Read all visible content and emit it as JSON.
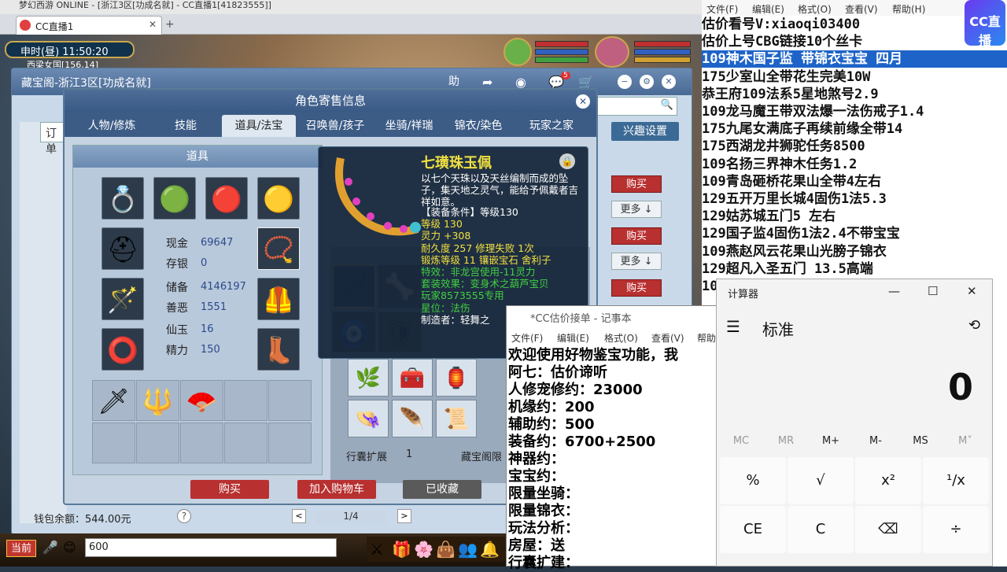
{
  "browser": {
    "top_text": "梦幻西游 ONLINE  -  [浙江3区[功成名就]  -  CC直播1[41823555]]",
    "tab_label": "CC直播1",
    "tab_close": "✕",
    "tab_add": "+"
  },
  "game": {
    "clock": "申时(昼)   11:50:20",
    "zone": "西梁女国[156,14]"
  },
  "cbg": {
    "title": "藏宝阁-浙江3区[功成名就]",
    "help": "助",
    "notif_count": "5",
    "order_tab": "订单",
    "interest_button": "兴趣设置",
    "buy_label": "购买",
    "more_label": "更多 ↓",
    "wallet": "钱包余额：544.00元",
    "help_q": "?",
    "page": "1/4",
    "prev": "<",
    "next": ">"
  },
  "role": {
    "title": "角色寄售信息",
    "close": "✕",
    "tabs": [
      "人物/修炼",
      "技能",
      "道具/法宝",
      "召唤兽/孩子",
      "坐骑/祥瑞",
      "锦衣/染色",
      "玩家之家"
    ],
    "active_tab": 2,
    "props_header": "道具",
    "stats": [
      {
        "label": "现金",
        "value": "69647"
      },
      {
        "label": "存银",
        "value": "0"
      },
      {
        "label": "储备",
        "value": "4146197"
      },
      {
        "label": "善恶",
        "value": "1551"
      },
      {
        "label": "仙玉",
        "value": "16"
      },
      {
        "label": "精力",
        "value": "150"
      }
    ],
    "bag_expand": "行囊扩展",
    "bag_expand_value": "1",
    "vault_label": "藏宝阁限",
    "buy_button": "购买",
    "add_cart_button": "加入购物车",
    "favorited_button": "已收藏"
  },
  "tooltip": {
    "name": "七璜珠玉佩",
    "lock": "🔒",
    "desc": "以七个天珠以及天丝编制而成的坠子，集天地之灵气，能给予佩戴者吉祥如意。",
    "lines": [
      {
        "text": "【装备条件】等级130",
        "color": "#ffffff"
      },
      {
        "text": "等级 130",
        "color": "#f0e040"
      },
      {
        "text": "灵力 +308",
        "color": "#f0e040"
      },
      {
        "text": "耐久度 257   修理失败 1次",
        "color": "#f0e040"
      },
      {
        "text": "锻炼等级 11   镶嵌宝石 舍利子",
        "color": "#f0e040"
      },
      {
        "text": "特效：非龙宫使用-11灵力",
        "color": "#40d040"
      },
      {
        "text": "套装效果：变身术之葫芦宝贝",
        "color": "#40d040"
      },
      {
        "text": "玩家8573555专用",
        "color": "#40d040"
      },
      {
        "text": "星位：法伤",
        "color": "#40d040"
      },
      {
        "text": "制造者：轻舞之",
        "color": "#ffffff"
      }
    ]
  },
  "bottom": {
    "current": "当前",
    "chat_text": "600"
  },
  "overlay": {
    "menu": [
      "文件(F)",
      "编辑(E)",
      "格式(O)",
      "查看(V)",
      "帮助(H)"
    ],
    "lines": [
      "估价看号V:xiaoqi03400",
      "估价上号CBG链接10个丝卡",
      "109神木国子监 带锦衣宝宝 四月",
      "175少室山全带花生完美10W",
      "恭王府109法系5星地煞号2.9",
      "109龙马魔王带双法爆一法伤戒子1.4",
      "175九尾女满底子再续前缘全带14",
      "175西湖龙井狮驼任务8500",
      "109名扬三界神木任务1.2",
      "109青岛砸桥花果山全带4左右",
      "129五开万里长城4固伤1法5.3",
      "129姑苏城五门5 左右",
      "129国子监4固伤1法2.4不带宝宝",
      "109燕赵风云花果山光膀子锦衣",
      "129超凡入圣五门  13.5高端",
      "10"
    ],
    "selected_index": 2,
    "logo": "CC直播"
  },
  "notepad": {
    "title": "*CC估价接单 - 记事本",
    "menu": [
      "文件(F)",
      "编辑(E)",
      "格式(O)",
      "查看(V)",
      "帮助"
    ],
    "lines": [
      "欢迎使用好物鉴宝功能，我",
      "阿七：估价谛听",
      "人修宠修约：23000",
      "机缘约：200",
      "辅助约：500",
      "装备约：6700+2500",
      "神器约：",
      "宝宝约：",
      "限量坐骑：",
      "限量锦衣：",
      "玩法分析：",
      "房屋：送",
      "行囊扩建："
    ]
  },
  "calculator": {
    "title": "计算器",
    "mode": "标准",
    "display": "0",
    "memory": [
      "MC",
      "MR",
      "M+",
      "M-",
      "MS",
      "M˅"
    ],
    "row1": [
      "%",
      "√",
      "x²",
      "¹/x"
    ],
    "row2": [
      "CE",
      "C",
      "⌫",
      "÷"
    ]
  }
}
